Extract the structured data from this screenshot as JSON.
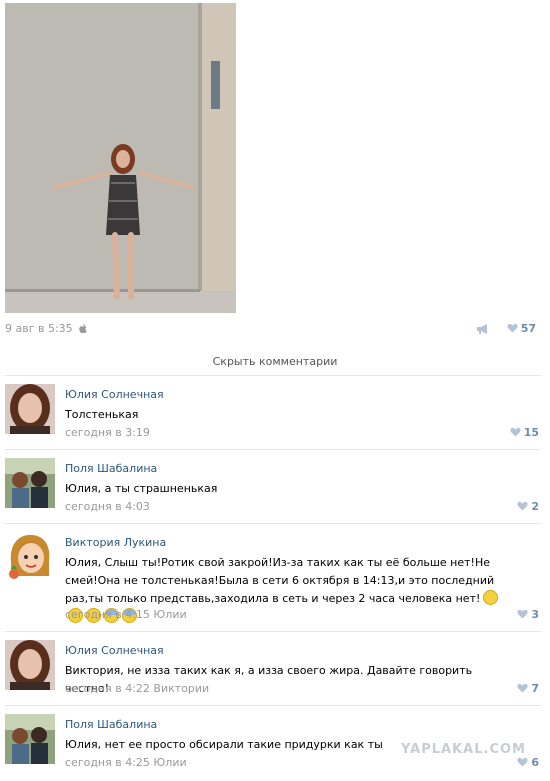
{
  "post": {
    "date": "9 авг в 5:35",
    "likes": "57",
    "icons": {
      "platform": "apple-icon",
      "share": "megaphone-icon",
      "like": "heart-icon"
    }
  },
  "hide_comments_label": "Скрыть комментарии",
  "comments": [
    {
      "author": "Юлия Солнечная",
      "text": "Толстенькая",
      "meta": "сегодня в 3:19",
      "likes": "15"
    },
    {
      "author": "Поля Шабалина",
      "text": "Юлия, а ты страшненькая",
      "meta": "сегодня в 4:03",
      "likes": "2"
    },
    {
      "author": "Виктория Лукина",
      "text": "Юлия, Слыш ты!Ротик свой закрой!Из-за таких как ты её больше нет!Не смей!Она не толстенькая!Была в сети 6 октября в 14:13,и это последний раз,ты только представь,заходила в сеть и через 2 часа человека нет!",
      "meta": "сегодня в 4:15 Юлии",
      "likes": "3"
    },
    {
      "author": "Юлия Солнечная",
      "text": "Виктория, не изза таких как я, а изза своего жира. Давайте говорить честно!",
      "meta": "сегодня в 4:22 Виктории",
      "likes": "7"
    },
    {
      "author": "Поля Шабалина",
      "text": "Юлия, нет ее просто обсирали такие придурки как ты",
      "meta": "сегодня в 4:25 Юлии",
      "likes": "6"
    }
  ],
  "watermark": "YAPLAKAL.COM",
  "colors": {
    "link": "#2b587a",
    "meta": "#999999",
    "like": "#6e8cab",
    "divider": "#e4e8ed"
  }
}
